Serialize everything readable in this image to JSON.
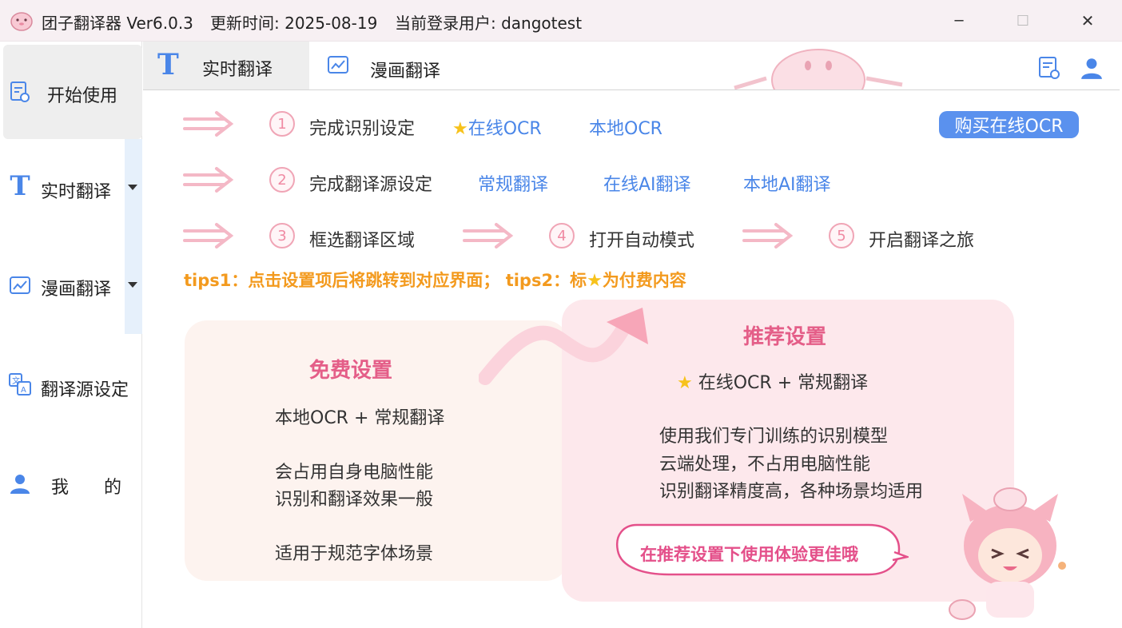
{
  "window": {
    "app_title": "团子翻译器 Ver6.0.3",
    "update_time": "更新时间: 2025-08-19",
    "current_user": "当前登录用户: dangotest",
    "minimize": "─",
    "maximize": "☐",
    "close": "✕"
  },
  "sidebar": {
    "items": [
      {
        "label": "开始使用",
        "icon": "start-doc-icon"
      },
      {
        "label": "实时翻译",
        "icon": "text-t-icon"
      },
      {
        "label": "漫画翻译",
        "icon": "chart-image-icon"
      },
      {
        "label": "翻译源设定",
        "icon": "translate-source-icon"
      },
      {
        "label": "我　　的",
        "icon": "user-icon"
      }
    ]
  },
  "tabs": [
    {
      "label": "实时翻译",
      "icon": "text-t-icon"
    },
    {
      "label": "漫画翻译",
      "icon": "chart-image-icon"
    }
  ],
  "steps": {
    "row1": {
      "num": "1",
      "text": "完成识别设定",
      "options": [
        "在线OCR",
        "本地OCR"
      ]
    },
    "row2": {
      "num": "2",
      "text": "完成翻译源设定",
      "options": [
        "常规翻译",
        "在线AI翻译",
        "本地AI翻译"
      ]
    },
    "row3": [
      {
        "num": "3",
        "text": "框选翻译区域"
      },
      {
        "num": "4",
        "text": "打开自动模式"
      },
      {
        "num": "5",
        "text": "开启翻译之旅"
      }
    ]
  },
  "buy_button": "购买在线OCR",
  "tips": {
    "before_star": "tips1：点击设置项后将跳转到对应界面； tips2：标",
    "after_star": "为付费内容"
  },
  "free_card": {
    "title": "免费设置",
    "line1": "本地OCR + 常规翻译",
    "line2": "会占用自身电脑性能",
    "line3": "识别和翻译效果一般",
    "line4": "适用于规范字体场景"
  },
  "recommend_card": {
    "title": "推荐设置",
    "line1": "在线OCR + 常规翻译",
    "line2": "使用我们专门训练的识别模型",
    "line3": "云端处理，不占用电脑性能",
    "line4": "识别翻译精度高，各种场景均适用"
  },
  "bubble_text": "在推荐设置下使用体验更佳哦",
  "colors": {
    "accent_blue": "#4a86e8",
    "button_blue": "#5a91ee",
    "pink": "#e45e88",
    "tips_orange": "#f39a1e",
    "star": "#f7c21b"
  }
}
